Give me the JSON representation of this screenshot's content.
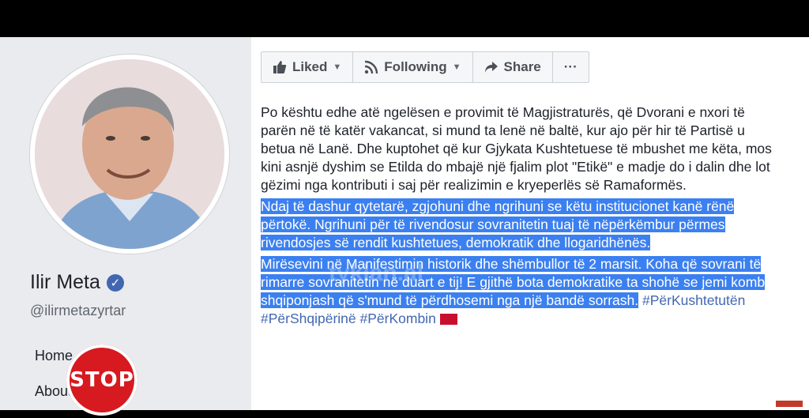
{
  "profile": {
    "name": "Ilir Meta",
    "handle": "@ilirmetazyrtar",
    "nav": [
      "Home",
      "About"
    ]
  },
  "toolbar": {
    "liked_label": "Liked",
    "following_label": "Following",
    "share_label": "Share",
    "more_label": "···"
  },
  "post": {
    "paragraph1": "Po kështu edhe atë ngelësen e provimit të Magjistraturës, që Dvorani e nxori të parën në të katër vakancat, si mund ta lenë në baltë, kur ajo për hir të Partisë u betua në Lanë. Dhe kuptohet që kur Gjykata Kushtetuese të mbushet me këta, mos kini asnjë dyshim se Etilda do mbajë një fjalim plot \"Etikë\" e madje do i dalin dhe lot gëzimi nga kontributi i saj për realizimin e kryeperlës së Ramaformës.",
    "paragraph2": "Ndaj të dashur qytetarë, zgjohuni dhe ngrihuni se këtu institucionet kanë rënë përtokë. Ngrihuni për të rivendosur sovranitetin tuaj të nëpërkëmbur përmes rivendosjes së rendit kushtetues, demokratik dhe llogaridhënës.",
    "paragraph3": "Mirësevini në Manifestimin historik dhe shëmbullor të 2 marsit. Koha që sovrani të rimarre sovranitetin në duart e tij! E gjithë bota demokratike ta shohë se jemi komb shqiponjash që s'mund të përdhosemi nga një bandë sorrash.",
    "hashtags": "#PërKushtetutën #PërShqipërinë #PërKombin"
  },
  "overlay": {
    "watermark": "tyklan.al",
    "stop_text": "STOP"
  },
  "colors": {
    "highlight": "#3b80f0",
    "facebook_blue": "#4267b2",
    "stop_red": "#d71920"
  }
}
